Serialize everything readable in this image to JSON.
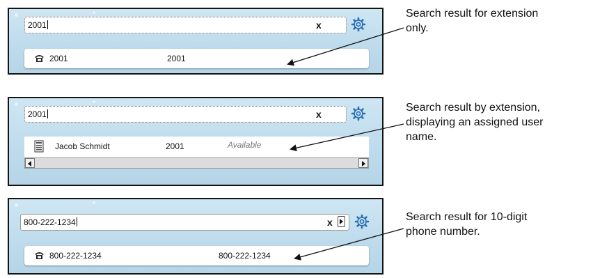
{
  "colors": {
    "panel_bg": "#c6e0ef",
    "panel_border": "#141414",
    "gear": "#2a6fb3",
    "arrow": "#111111"
  },
  "panels": [
    {
      "search_value": "2001",
      "clear_label": "x",
      "result": {
        "icon": "desk-phone-icon",
        "name": "2001",
        "number": "2001",
        "status": ""
      },
      "note": [
        "Search result for extension",
        "only."
      ]
    },
    {
      "search_value": "2001",
      "clear_label": "x",
      "result": {
        "icon": "user-card-icon",
        "name": "Jacob Schmidt",
        "number": "2001",
        "status": "Available"
      },
      "note": [
        "Search result by extension,",
        "displaying an assigned user",
        "name."
      ]
    },
    {
      "search_value": "800-222-1234",
      "clear_label": "x",
      "result": {
        "icon": "desk-phone-icon",
        "name": "800-222-1234",
        "number": "800-222-1234",
        "status": ""
      },
      "note": [
        "Search result for 10-digit",
        "phone number."
      ]
    }
  ]
}
